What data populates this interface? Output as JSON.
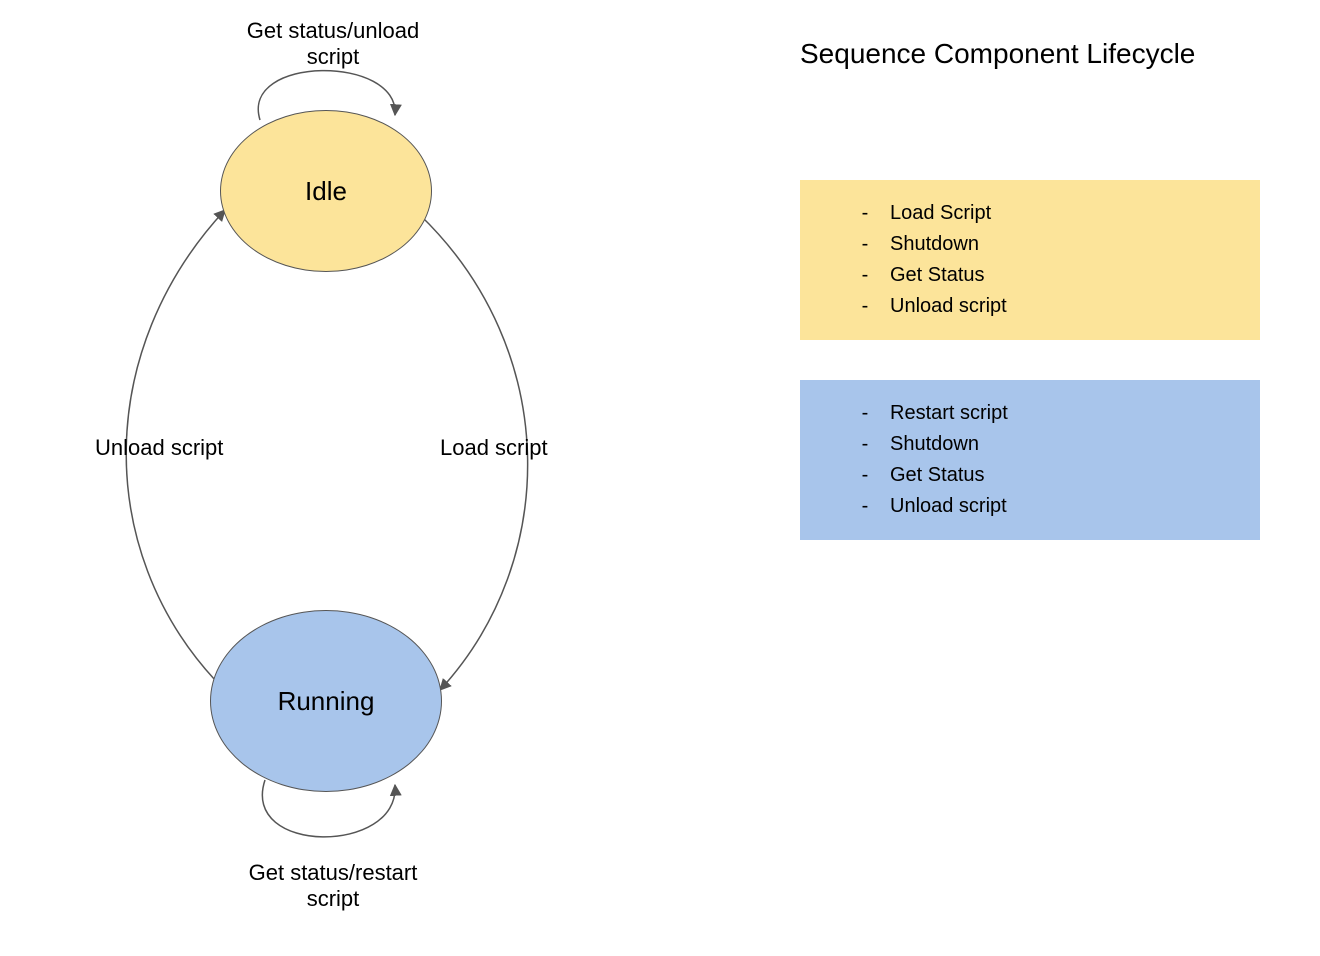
{
  "title": "Sequence Component Lifecycle",
  "nodes": {
    "idle": {
      "label": "Idle",
      "color": "#fce49a"
    },
    "running": {
      "label": "Running",
      "color": "#a8c5eb"
    }
  },
  "edge_labels": {
    "idle_self": "Get status/unload\nscript",
    "running_self": "Get status/restart\nscript",
    "idle_to_running": "Load script",
    "running_to_idle": "Unload script"
  },
  "legend": {
    "idle_actions": [
      "Load Script",
      "Shutdown",
      "Get Status",
      "Unload script"
    ],
    "running_actions": [
      "Restart script",
      "Shutdown",
      "Get Status",
      "Unload script"
    ]
  }
}
